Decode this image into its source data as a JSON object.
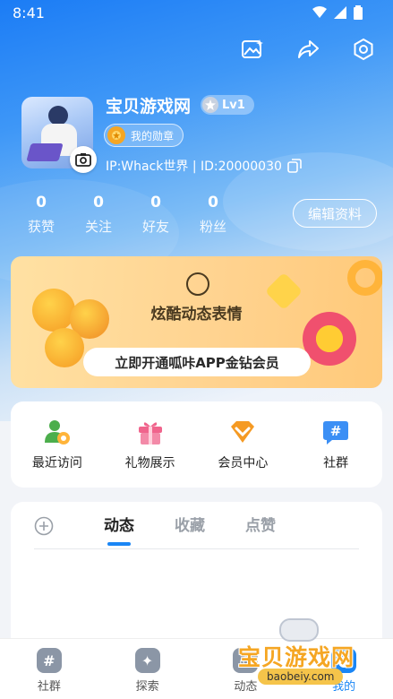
{
  "status_bar": {
    "time": "8:41"
  },
  "profile": {
    "username": "宝贝游戏网",
    "level": "Lv1",
    "medal_label": "我的勋章",
    "ip_line": "IP:Whack世界 | ID:20000030",
    "edit_label": "编辑资料",
    "stats": [
      {
        "value": "0",
        "label": "获赞"
      },
      {
        "value": "0",
        "label": "关注"
      },
      {
        "value": "0",
        "label": "好友"
      },
      {
        "value": "0",
        "label": "粉丝"
      }
    ]
  },
  "banner": {
    "title": "炫酷动态表情",
    "cta": "立即开通呱咔APP金钻会员"
  },
  "quick_links": [
    {
      "label": "最近访问",
      "icon": "recent-visitor-icon",
      "color": "#4cae4c"
    },
    {
      "label": "礼物展示",
      "icon": "gift-icon",
      "color": "#f0648c"
    },
    {
      "label": "会员中心",
      "icon": "vip-icon",
      "color": "#f59a23"
    },
    {
      "label": "社群",
      "icon": "community-icon",
      "color": "#3b8ff5"
    }
  ],
  "feed_tabs": [
    {
      "label": "动态",
      "active": true
    },
    {
      "label": "收藏",
      "active": false
    },
    {
      "label": "点赞",
      "active": false
    }
  ],
  "bottom_nav": [
    {
      "label": "社群",
      "glyph": "#"
    },
    {
      "label": "探索",
      "glyph": "✦"
    },
    {
      "label": "动态",
      "glyph": "◎"
    },
    {
      "label": "我的",
      "glyph": "●",
      "active": true
    }
  ],
  "watermark": {
    "text": "宝贝游戏网",
    "url": "baobeiy.com"
  },
  "colors": {
    "accent": "#1a86f5",
    "banner_bg": "#ffd390",
    "medal": "#f5a623"
  }
}
